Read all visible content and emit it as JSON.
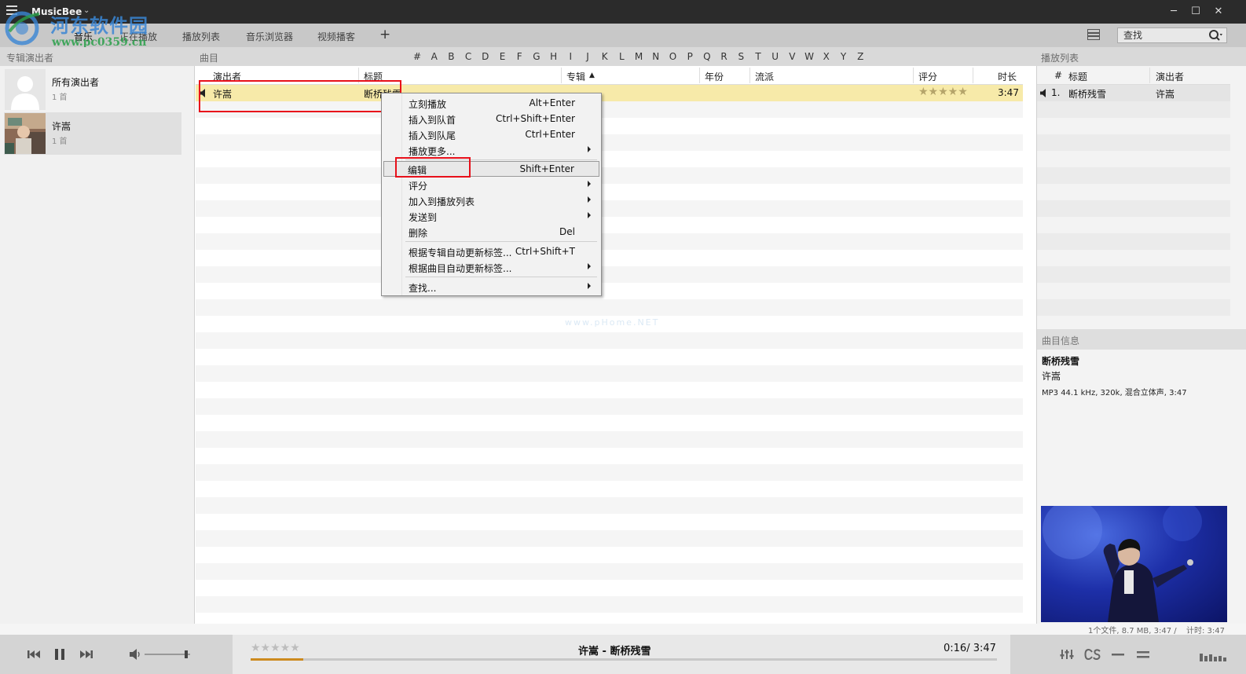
{
  "app": {
    "title": "MusicBee",
    "caret": "⌄"
  },
  "watermark": {
    "text": "河东软件园",
    "url": "www.pc0359.cn",
    "faint": "www.pHome.NET"
  },
  "tabs": [
    {
      "label": "音乐",
      "active": true
    },
    {
      "label": "正在播放",
      "active": false
    },
    {
      "label": "播放列表",
      "active": false
    },
    {
      "label": "音乐浏览器",
      "active": false
    },
    {
      "label": "视频播客",
      "active": false
    }
  ],
  "tab_add": "+",
  "search": {
    "label": "查找"
  },
  "sections": {
    "left": "专辑演出者",
    "middle": "曲目",
    "right": "播放列表"
  },
  "alphabet": [
    "#",
    "A",
    "B",
    "C",
    "D",
    "E",
    "F",
    "G",
    "H",
    "I",
    "J",
    "K",
    "L",
    "M",
    "N",
    "O",
    "P",
    "Q",
    "R",
    "S",
    "T",
    "U",
    "V",
    "W",
    "X",
    "Y",
    "Z"
  ],
  "artists": [
    {
      "name": "所有演出者",
      "count": "1 首",
      "selected": false
    },
    {
      "name": "许嵩",
      "count": "1 首",
      "selected": true
    }
  ],
  "columns": [
    "演出者",
    "标题",
    "专辑",
    "年份",
    "流派",
    "评分",
    "时长"
  ],
  "sort_arrow": "▲",
  "tracks": [
    {
      "artist": "许嵩",
      "title": "断桥残雪",
      "album": "",
      "year": "",
      "genre": "",
      "rating": "★★★★★",
      "duration": "3:47",
      "playing": true
    }
  ],
  "context_menu": {
    "groups": [
      [
        {
          "label": "立刻播放",
          "shortcut": "Alt+Enter",
          "submenu": false
        },
        {
          "label": "插入到队首",
          "shortcut": "Ctrl+Shift+Enter",
          "submenu": false
        },
        {
          "label": "插入到队尾",
          "shortcut": "Ctrl+Enter",
          "submenu": false
        },
        {
          "label": "播放更多...",
          "shortcut": "",
          "submenu": true
        }
      ],
      [
        {
          "label": "编辑",
          "shortcut": "Shift+Enter",
          "submenu": false,
          "highlighted": true
        },
        {
          "label": "评分",
          "shortcut": "",
          "submenu": true
        },
        {
          "label": "加入到播放列表",
          "shortcut": "",
          "submenu": true
        },
        {
          "label": "发送到",
          "shortcut": "",
          "submenu": true
        },
        {
          "label": "删除",
          "shortcut": "Del",
          "submenu": false
        }
      ],
      [
        {
          "label": "根据专辑自动更新标签...",
          "shortcut": "Ctrl+Shift+T",
          "submenu": false
        },
        {
          "label": "根据曲目自动更新标签...",
          "shortcut": "",
          "submenu": true
        }
      ],
      [
        {
          "label": "查找...",
          "shortcut": "",
          "submenu": true
        }
      ]
    ]
  },
  "playlist": {
    "columns": [
      "#",
      "标题",
      "演出者"
    ],
    "items": [
      {
        "num": "1.",
        "title": "断桥残雪",
        "artist": "许嵩"
      }
    ]
  },
  "track_info": {
    "header": "曲目信息",
    "title": "断桥残雪",
    "artist": "许嵩",
    "details": "MP3 44.1 kHz, 320k, 混合立体声, 3:47"
  },
  "status": {
    "files": "1个文件, 8.7 MB, 3:47 /",
    "timer": "计时: 3:47"
  },
  "player": {
    "now_playing": "许嵩 - 断桥残雪",
    "time": "0:16/ 3:47",
    "progress": 0.07,
    "volume": 0.95,
    "rating": "★★★★★"
  },
  "colors": {
    "playing_row": "#f7eaa9",
    "progress": "#cc8a1e",
    "annotation": "#e8101a"
  }
}
